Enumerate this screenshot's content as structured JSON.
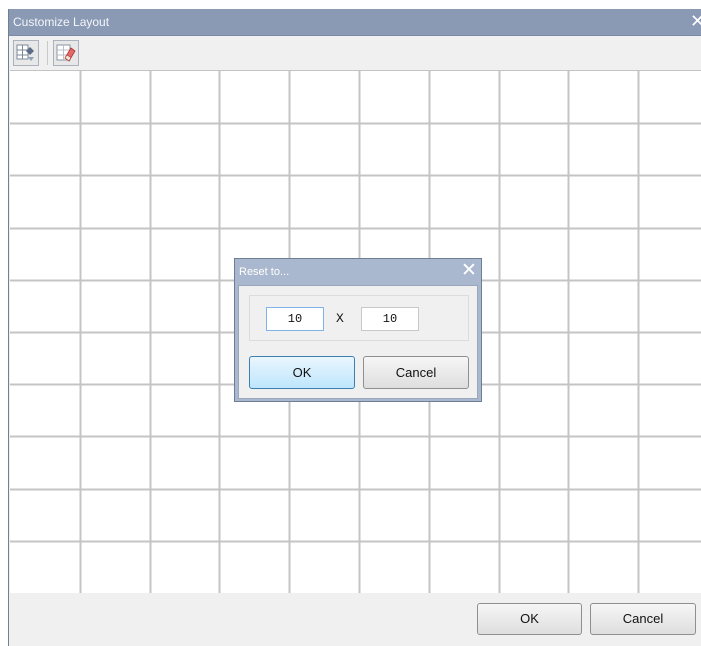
{
  "window": {
    "title": "Customize Layout",
    "close_glyph": "✕"
  },
  "toolbar": {
    "buttons": [
      {
        "name": "apply-layout-icon"
      },
      {
        "name": "eraser-icon"
      }
    ]
  },
  "grid": {
    "columns": 10,
    "rows": 10
  },
  "footer": {
    "ok_label": "OK",
    "cancel_label": "Cancel"
  },
  "reset_dialog": {
    "title": "Reset to...",
    "close_glyph": "✕",
    "rows_value": "10",
    "separator": "X",
    "cols_value": "10",
    "ok_label": "OK",
    "cancel_label": "Cancel"
  },
  "colors": {
    "titlebar": "#8a9ab5",
    "grid_line": "#c4c4c4",
    "focused_button": "#bee6fd"
  }
}
